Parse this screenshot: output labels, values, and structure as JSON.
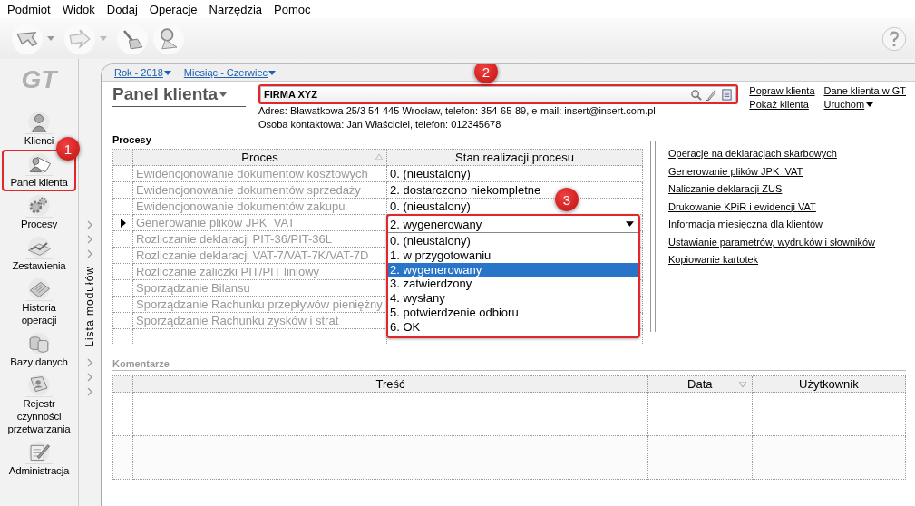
{
  "menu": [
    "Podmiot",
    "Widok",
    "Dodaj",
    "Operacje",
    "Narzędzia",
    "Pomoc"
  ],
  "sidebar": {
    "logo": "GT",
    "items": [
      {
        "label": "Klienci",
        "highlighted": false
      },
      {
        "label": "Panel klienta",
        "highlighted": true,
        "callout": "1"
      },
      {
        "label": "Procesy",
        "highlighted": false
      },
      {
        "label": "Zestawienia",
        "highlighted": false
      },
      {
        "label": "Historia operacji",
        "highlighted": false
      },
      {
        "label": "Bazy danych",
        "highlighted": false
      },
      {
        "label": "Rejestr czynności przetwarzania",
        "highlighted": false
      },
      {
        "label": "Administracja",
        "highlighted": false
      }
    ]
  },
  "module_strip": {
    "label": "Lista modułów"
  },
  "period_links": [
    "Rok - 2018",
    "Miesiąc - Czerwiec"
  ],
  "panel": {
    "title": "Panel klienta",
    "client": {
      "name": "FIRMA XYZ",
      "highlighted": true,
      "callout": "2",
      "address": "Adres: Bławatkowa 25/3 54-445 Wrocław, telefon: 354-65-89, e-mail: insert@insert.com.pl",
      "contact": "Osoba kontaktowa: Jan Właściciel, telefon: 012345678"
    },
    "actions": [
      {
        "label": "Popraw klienta",
        "kind": "link"
      },
      {
        "label": "Dane klienta w GT",
        "kind": "link"
      },
      {
        "label": "Pokaż klienta",
        "kind": "link"
      },
      {
        "label": "Uruchom",
        "kind": "menu"
      }
    ]
  },
  "processes": {
    "title": "Procesy",
    "columns": [
      "Proces",
      "Stan realizacji procesu"
    ],
    "rows": [
      {
        "process": "Ewidencjonowanie dokumentów kosztowych",
        "status": "0. (nieustalony)",
        "selected": false
      },
      {
        "process": "Ewidencjonowanie dokumentów sprzedaży",
        "status": "2. dostarczono niekompletne",
        "selected": false
      },
      {
        "process": "Ewidencjonowanie dokumentów zakupu",
        "status": "0. (nieustalony)",
        "selected": false
      },
      {
        "process": "Generowanie plików JPK_VAT",
        "status": "2. wygenerowany",
        "selected": true
      },
      {
        "process": "Rozliczanie deklaracji PIT-36/PIT-36L",
        "selected": false
      },
      {
        "process": "Rozliczanie deklaracji VAT-7/VAT-7K/VAT-7D",
        "selected": false
      },
      {
        "process": "Rozliczanie zaliczki PIT/PIT liniowy",
        "selected": false
      },
      {
        "process": "Sporządzanie Bilansu",
        "selected": false
      },
      {
        "process": "Sporządzanie Rachunku przepływów pieniężny",
        "selected": false
      },
      {
        "process": "Sporządzanie Rachunku zysków i strat",
        "selected": false
      }
    ],
    "dropdown": {
      "highlighted": true,
      "callout": "3",
      "options": [
        {
          "label": "0. (nieustalony)",
          "selected": false
        },
        {
          "label": "1. w przygotowaniu",
          "selected": false
        },
        {
          "label": "2. wygenerowany",
          "selected": true
        },
        {
          "label": "3. zatwierdzony",
          "selected": false
        },
        {
          "label": "4. wysłany",
          "selected": false
        },
        {
          "label": "5. potwierdzenie odbioru",
          "selected": false
        },
        {
          "label": "6. OK",
          "selected": false
        }
      ]
    }
  },
  "side_links": [
    "Operacje na deklaracjach skarbowych",
    "Generowanie plików JPK_VAT",
    "Naliczanie deklaracji ZUS",
    "Drukowanie KPiR i ewidencji VAT",
    "Informacja miesięczna dla klientów",
    "Ustawianie parametrów, wydruków i słowników",
    "Kopiowanie kartotek"
  ],
  "comments": {
    "title": "Komentarze",
    "columns": [
      "Treść",
      "Data",
      "Użytkownik"
    ]
  }
}
